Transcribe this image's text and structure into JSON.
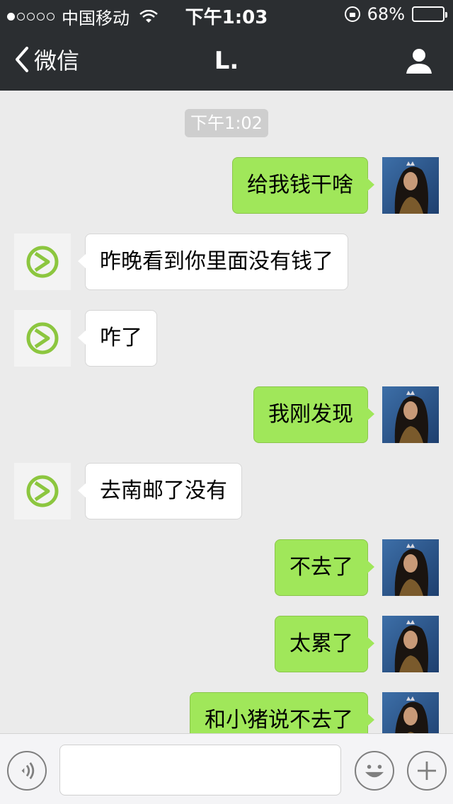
{
  "status_bar": {
    "carrier": "中国移动",
    "time": "下午1:03",
    "battery": "68%",
    "battery_level": 0.68
  },
  "nav": {
    "back_label": "微信",
    "title": "L."
  },
  "chat": {
    "timestamp": "下午1:02",
    "messages": [
      {
        "from": "me",
        "text": "给我钱干啥"
      },
      {
        "from": "other",
        "text": "昨晚看到你里面没有钱了"
      },
      {
        "from": "other",
        "text": "咋了"
      },
      {
        "from": "me",
        "text": "我刚发现"
      },
      {
        "from": "other",
        "text": "去南邮了没有"
      },
      {
        "from": "me",
        "text": "不去了"
      },
      {
        "from": "me",
        "text": "太累了"
      },
      {
        "from": "me",
        "text": "和小猪说不去了"
      }
    ]
  },
  "input_bar": {
    "message_value": "",
    "icons": [
      "voice-icon",
      "emoji-icon",
      "plus-icon"
    ]
  },
  "colors": {
    "nav_bg": "#2b2e31",
    "chat_bg": "#ebebeb",
    "my_bubble": "#a0e75a",
    "other_bubble": "#ffffff",
    "contact_logo": "#8cc63f"
  }
}
